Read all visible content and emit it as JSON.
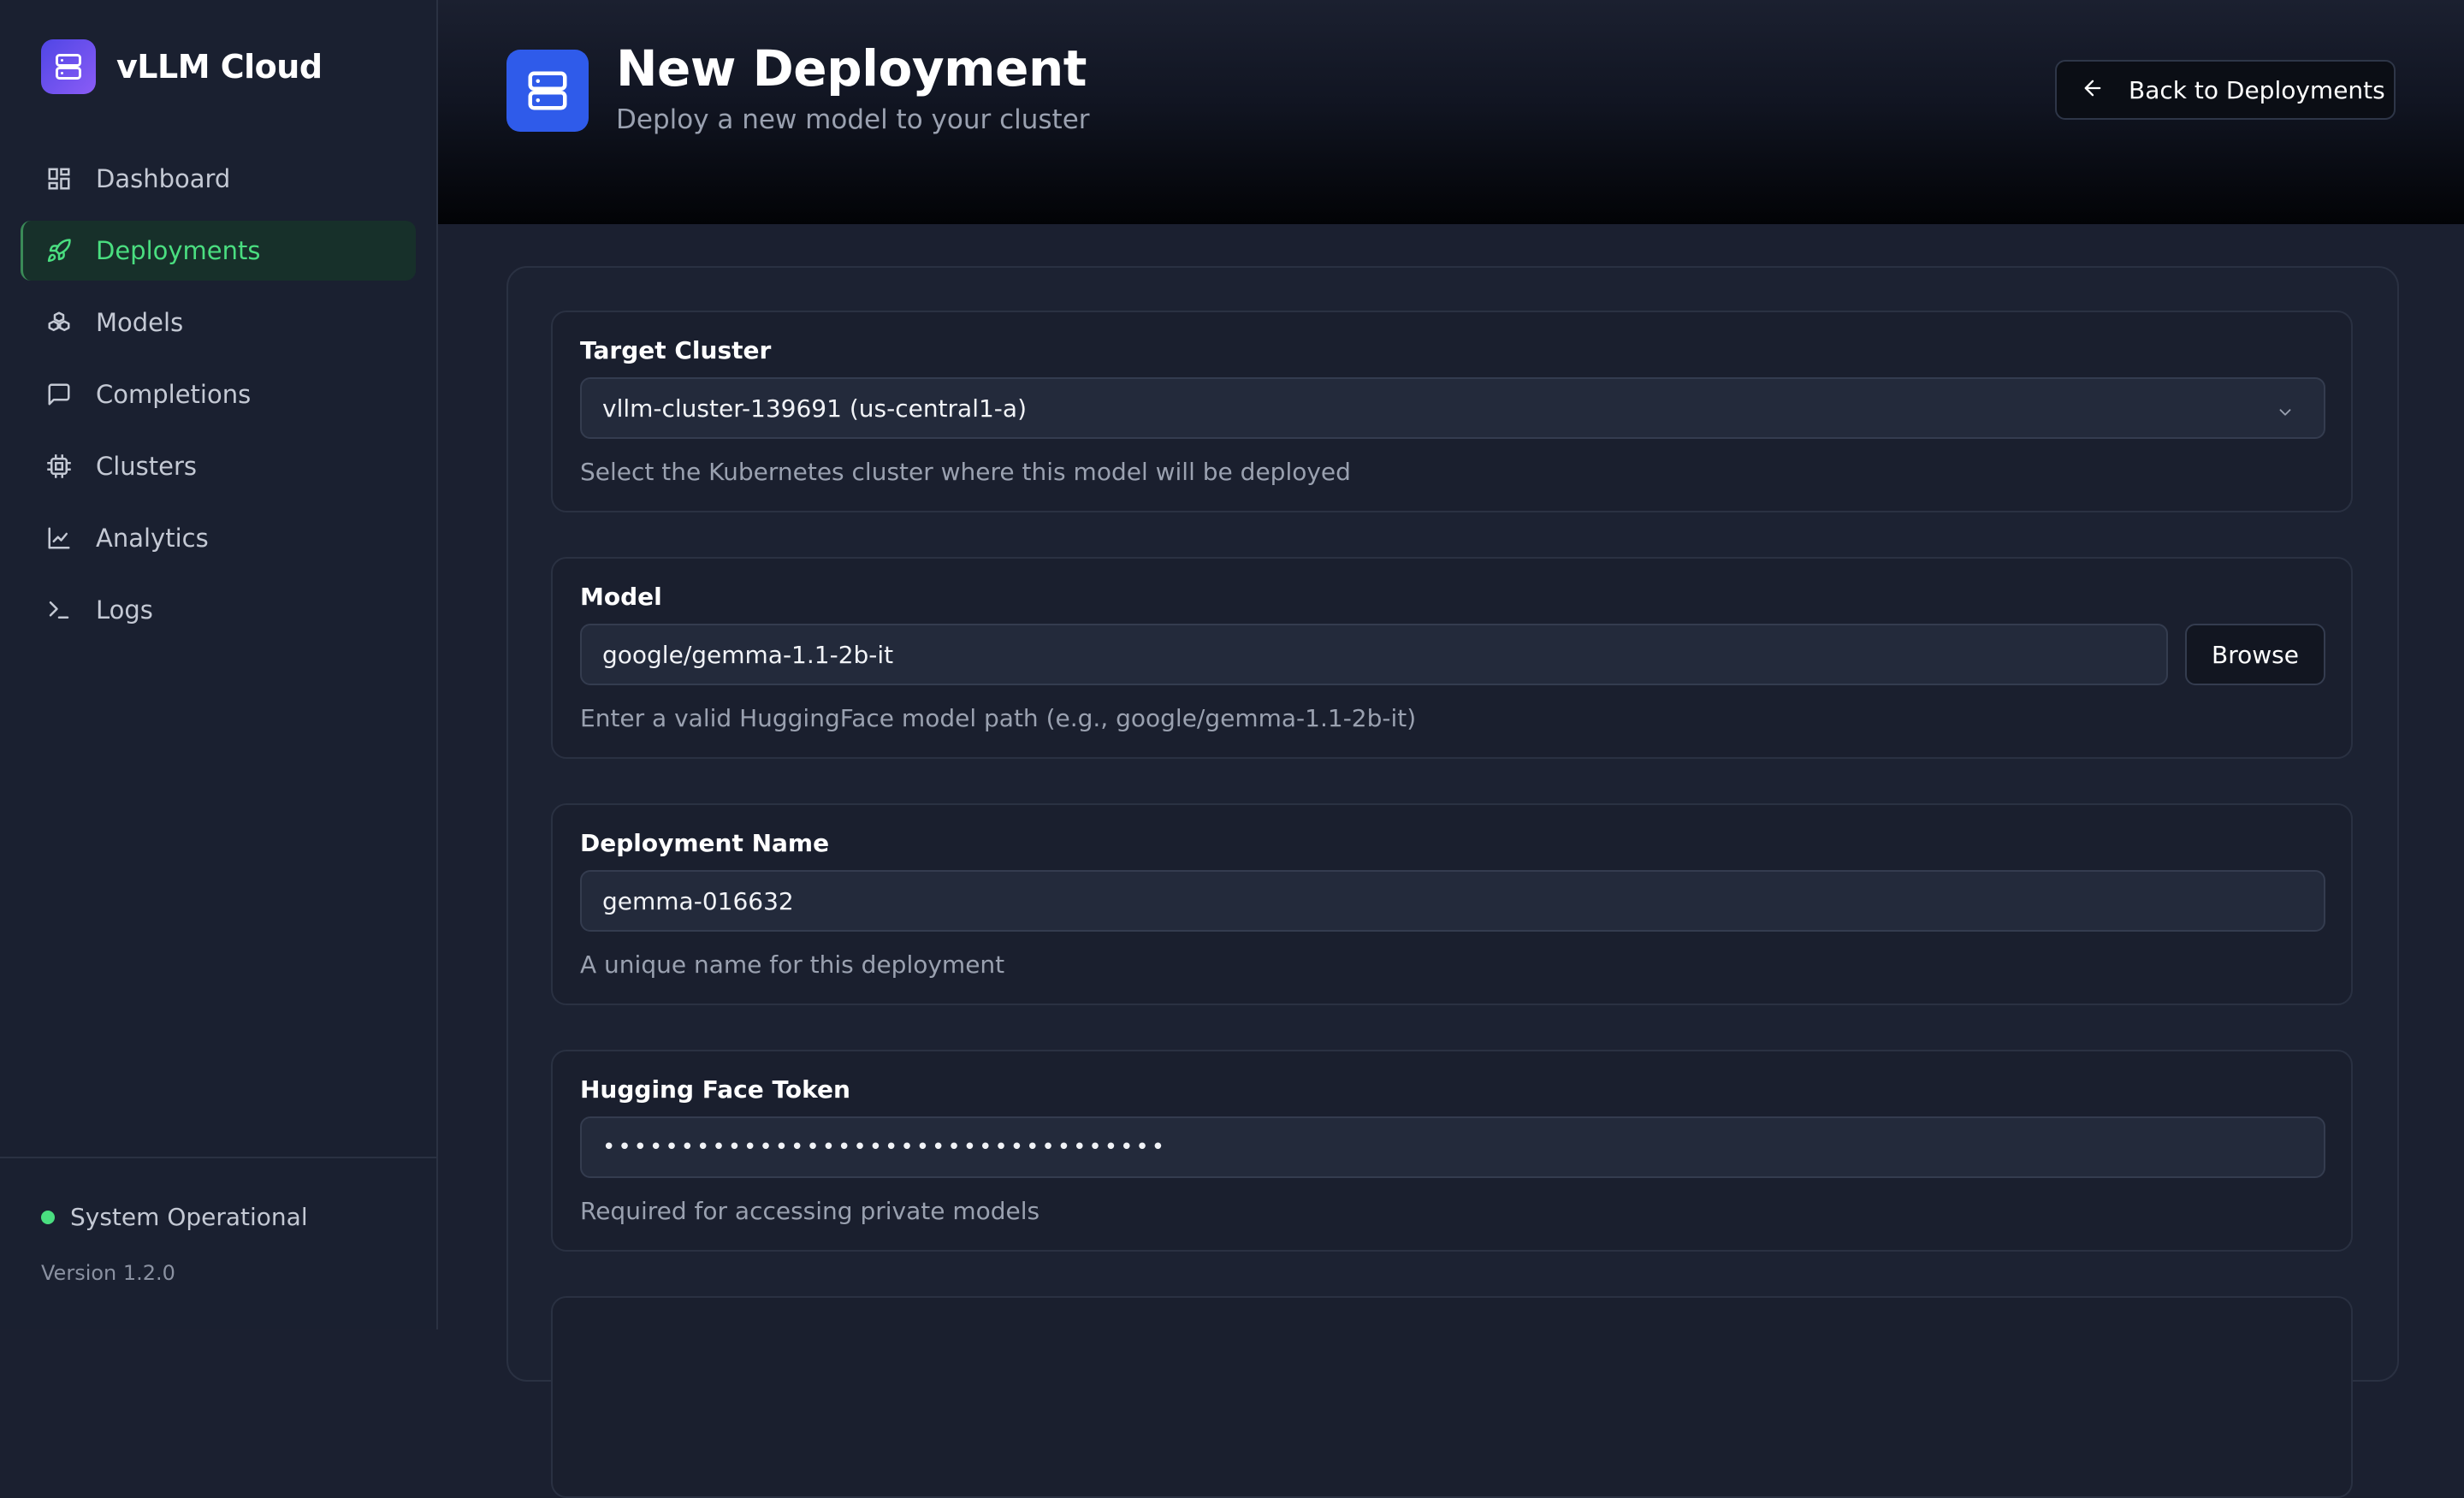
{
  "app": {
    "name": "vLLM Cloud"
  },
  "sidebar": {
    "items": [
      {
        "label": "Dashboard",
        "icon": "dashboard-grid-icon",
        "active": false
      },
      {
        "label": "Deployments",
        "icon": "rocket-icon",
        "active": true
      },
      {
        "label": "Models",
        "icon": "cubes-icon",
        "active": false
      },
      {
        "label": "Completions",
        "icon": "chat-bubble-icon",
        "active": false
      },
      {
        "label": "Clusters",
        "icon": "cpu-chip-icon",
        "active": false
      },
      {
        "label": "Analytics",
        "icon": "line-chart-icon",
        "active": false
      },
      {
        "label": "Logs",
        "icon": "terminal-icon",
        "active": false
      }
    ],
    "status": "System Operational",
    "version": "Version 1.2.0"
  },
  "header": {
    "title": "New Deployment",
    "subtitle": "Deploy a new model to your cluster",
    "back_label": "Back to Deployments"
  },
  "form": {
    "cluster": {
      "label": "Target Cluster",
      "value": "vllm-cluster-139691 (us-central1-a)",
      "help": "Select the Kubernetes cluster where this model will be deployed"
    },
    "model": {
      "label": "Model",
      "value": "google/gemma-1.1-2b-it",
      "browse_label": "Browse",
      "help": "Enter a valid HuggingFace model path (e.g., google/gemma-1.1-2b-it)"
    },
    "deployment_name": {
      "label": "Deployment Name",
      "value": "gemma-016632",
      "help": "A unique name for this deployment"
    },
    "hf_token": {
      "label": "Hugging Face Token",
      "masked_value": "••••••••••••••••••••••••••••••••••••",
      "help": "Required for accessing private models"
    }
  },
  "colors": {
    "accent_green": "#4ade80",
    "brand_gradient_start": "#4f46e5",
    "brand_gradient_end": "#8b5cf6",
    "header_icon": "#2f5bea"
  }
}
